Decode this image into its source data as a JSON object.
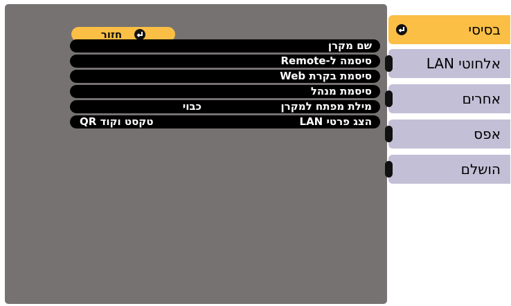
{
  "tabs": [
    {
      "label": "בסיסי",
      "active": true
    },
    {
      "label": "LAN אלחוטי",
      "active": false
    },
    {
      "label": "אחרים",
      "active": false
    },
    {
      "label": "אפס",
      "active": false
    },
    {
      "label": "הושלם",
      "active": false
    }
  ],
  "back_button": {
    "label": "חזור",
    "icon": "enter-icon"
  },
  "menu_rows": [
    {
      "label": "שם מקרן",
      "value": ""
    },
    {
      "label": "סיסמה ל-Remote",
      "value": ""
    },
    {
      "label": "סיסמת בקרת Web",
      "value": ""
    },
    {
      "label": "סיסמת מנהל",
      "value": ""
    },
    {
      "label": "מילת מפתח למקרן",
      "value": "כבוי"
    },
    {
      "label": "הצג פרטי LAN",
      "value": "טקסט וקוד QR"
    }
  ],
  "colors": {
    "accent": "#fbbf45",
    "tab": "#c3bfd6",
    "panel": "#767272",
    "row": "#000000"
  }
}
